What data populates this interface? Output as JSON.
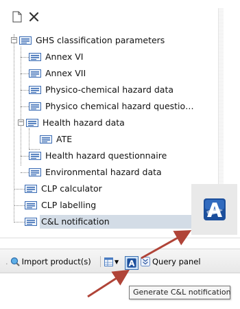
{
  "toolbar": {
    "new_icon": "new-document-icon",
    "delete_icon": "delete-x-icon"
  },
  "tree": {
    "root": {
      "label": "GHS classification parameters",
      "children": [
        {
          "label": "Annex VI"
        },
        {
          "label": "Annex VII"
        },
        {
          "label": "Physico-chemical hazard data"
        },
        {
          "label": "Physico chemical hazard questio…"
        },
        {
          "label": "Health hazard data",
          "children": [
            {
              "label": "ATE"
            }
          ]
        },
        {
          "label": "Health hazard questionnaire"
        },
        {
          "label": "Environmental hazard data"
        }
      ]
    },
    "items": [
      {
        "label": "CLP calculator"
      },
      {
        "label": "CLP labelling"
      },
      {
        "label": "C&L notification",
        "selected": true
      }
    ]
  },
  "bottom_toolbar": {
    "import_label": "Import product(s)",
    "query_label": "Query panel"
  },
  "tooltip": {
    "text": "Generate C&L notification"
  },
  "colors": {
    "selection": "#d3dce6",
    "arrow": "#b04438",
    "icon_blue": "#2e62b8"
  }
}
